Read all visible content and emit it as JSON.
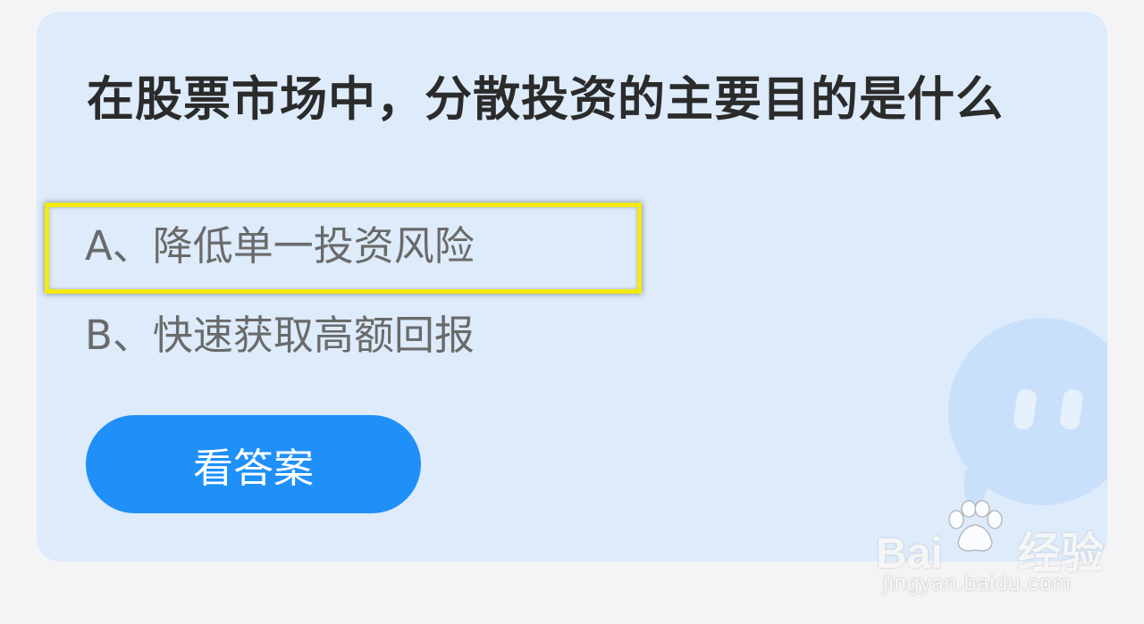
{
  "question": {
    "text": "在股票市场中，分散投资的主要目的是什么"
  },
  "options": [
    {
      "label": "A、降低单一投资风险",
      "highlighted": true
    },
    {
      "label": "B、快速获取高额回报",
      "highlighted": false
    }
  ],
  "answer_button": {
    "label": "看答案"
  },
  "watermark": {
    "brand": "Bai",
    "brand_suffix": "经验",
    "url": "jingyan.baidu.com"
  },
  "colors": {
    "page_bg": "#f4f4f7",
    "card_bg": "#ddebfb",
    "button_bg": "#1f90f8",
    "highlight": "#f4ea12",
    "mascot": "#c9e0fb"
  }
}
